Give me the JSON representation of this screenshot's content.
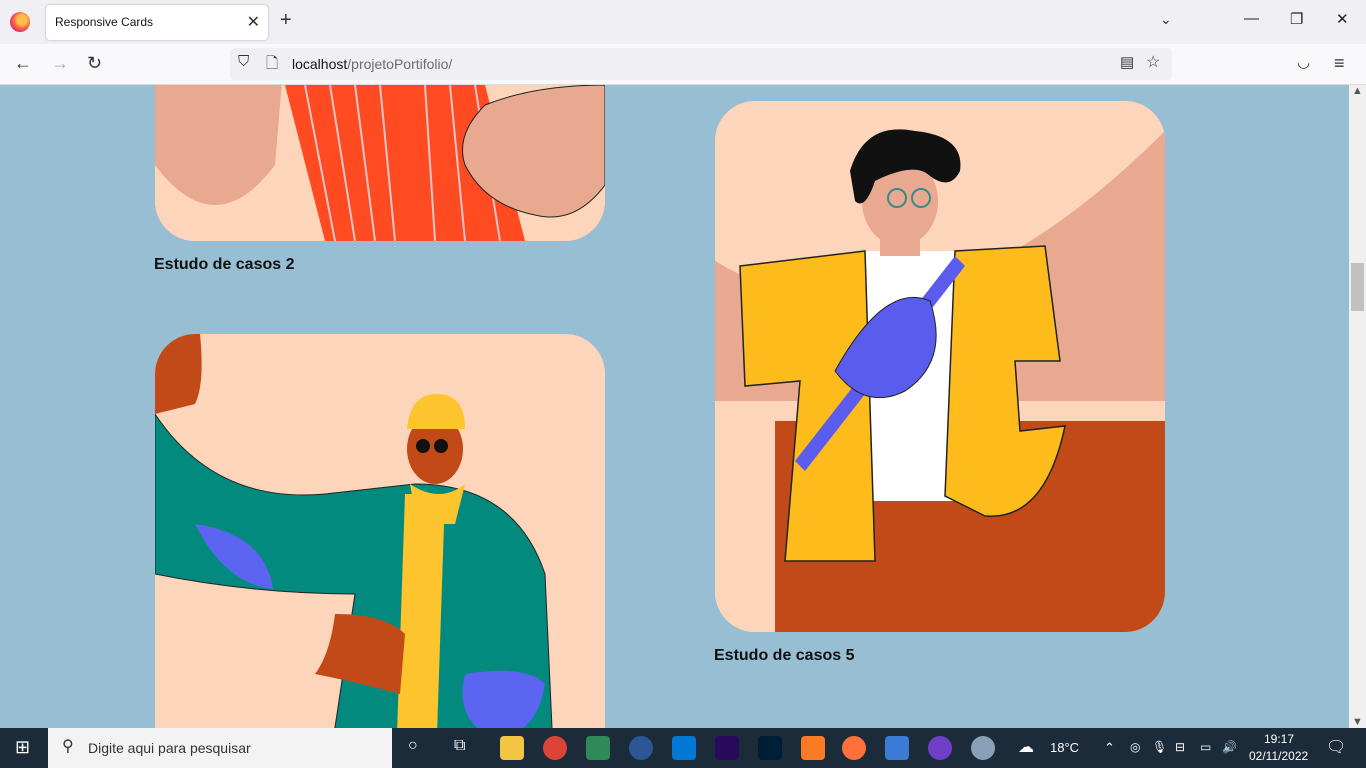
{
  "browser": {
    "tab_title": "Responsive Cards",
    "url_host": "localhost",
    "url_path": "/projetoPortifolio/"
  },
  "cards": [
    {
      "caption": "Estudo de casos 2"
    },
    {
      "caption": "Estudo de casos 5"
    }
  ],
  "taskbar": {
    "search_placeholder": "Digite aqui para pesquisar",
    "weather": "18°C",
    "time": "19:17",
    "date": "02/11/2022"
  }
}
